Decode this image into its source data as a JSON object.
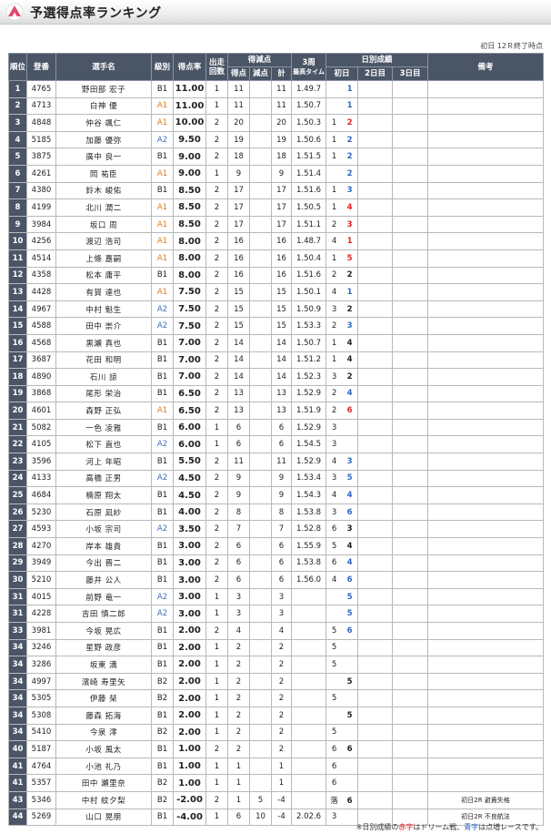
{
  "header": {
    "title": "予選得点率ランキング"
  },
  "status": "初日 12Ｒ終了時点",
  "columns": {
    "rank": "順位",
    "reg": "登番",
    "name": "選手名",
    "class": "級別",
    "rate": "得点率",
    "starts_top": "出走",
    "starts_bot": "回数",
    "points_group": "得減点",
    "got": "得点",
    "minus": "減点",
    "total": "計",
    "lap_top": "3周",
    "lap_bot": "最高タイム",
    "daily_group": "日別成績",
    "day1": "初日",
    "day2": "2日目",
    "day3": "3日目",
    "remarks": "備考"
  },
  "colors": {
    "header_bg": "#4a5566",
    "class_A1": "#e07a1b",
    "class_A2": "#3c6dc0",
    "dream_red": "#e52222",
    "feature_blue": "#2f66c2"
  },
  "rows": [
    {
      "rank": "1",
      "reg": "4765",
      "name": "野田部 宏子",
      "cls": "B1",
      "rate": "11.00",
      "starts": "1",
      "got": "11",
      "minus": "",
      "total": "11",
      "lap": "1.49.7",
      "d1a": "",
      "d1b": "1",
      "d1bc": "blue",
      "remark": ""
    },
    {
      "rank": "2",
      "reg": "4713",
      "name": "白神 優",
      "cls": "A1",
      "rate": "11.00",
      "starts": "1",
      "got": "11",
      "minus": "",
      "total": "11",
      "lap": "1.50.7",
      "d1a": "",
      "d1b": "1",
      "d1bc": "blue",
      "remark": ""
    },
    {
      "rank": "3",
      "reg": "4848",
      "name": "仲谷 颯仁",
      "cls": "A1",
      "rate": "10.00",
      "starts": "2",
      "got": "20",
      "minus": "",
      "total": "20",
      "lap": "1.50.3",
      "d1a": "1",
      "d1b": "2",
      "d1bc": "red",
      "remark": ""
    },
    {
      "rank": "4",
      "reg": "5185",
      "name": "加藤 優弥",
      "cls": "A2",
      "rate": "9.50",
      "starts": "2",
      "got": "19",
      "minus": "",
      "total": "19",
      "lap": "1.50.6",
      "d1a": "1",
      "d1b": "2",
      "d1bc": "blue",
      "remark": ""
    },
    {
      "rank": "5",
      "reg": "3875",
      "name": "廣中 良一",
      "cls": "B1",
      "rate": "9.00",
      "starts": "2",
      "got": "18",
      "minus": "",
      "total": "18",
      "lap": "1.51.5",
      "d1a": "1",
      "d1b": "2",
      "d1bc": "blue",
      "remark": ""
    },
    {
      "rank": "6",
      "reg": "4261",
      "name": "岡 祐臣",
      "cls": "A1",
      "rate": "9.00",
      "starts": "1",
      "got": "9",
      "minus": "",
      "total": "9",
      "lap": "1.51.4",
      "d1a": "",
      "d1b": "2",
      "d1bc": "blue",
      "remark": ""
    },
    {
      "rank": "7",
      "reg": "4380",
      "name": "鈴木 峻佑",
      "cls": "B1",
      "rate": "8.50",
      "starts": "2",
      "got": "17",
      "minus": "",
      "total": "17",
      "lap": "1.51.6",
      "d1a": "1",
      "d1b": "3",
      "d1bc": "blue",
      "remark": ""
    },
    {
      "rank": "8",
      "reg": "4199",
      "name": "北川 潤二",
      "cls": "A1",
      "rate": "8.50",
      "starts": "2",
      "got": "17",
      "minus": "",
      "total": "17",
      "lap": "1.50.5",
      "d1a": "1",
      "d1b": "4",
      "d1bc": "red",
      "remark": ""
    },
    {
      "rank": "9",
      "reg": "3984",
      "name": "坂口 周",
      "cls": "A1",
      "rate": "8.50",
      "starts": "2",
      "got": "17",
      "minus": "",
      "total": "17",
      "lap": "1.51.1",
      "d1a": "2",
      "d1b": "3",
      "d1bc": "red",
      "remark": ""
    },
    {
      "rank": "10",
      "reg": "4256",
      "name": "渡辺 浩司",
      "cls": "A1",
      "rate": "8.00",
      "starts": "2",
      "got": "16",
      "minus": "",
      "total": "16",
      "lap": "1.48.7",
      "d1a": "4",
      "d1b": "1",
      "d1bc": "red",
      "remark": ""
    },
    {
      "rank": "11",
      "reg": "4514",
      "name": "上條 嘉嗣",
      "cls": "A1",
      "rate": "8.00",
      "starts": "2",
      "got": "16",
      "minus": "",
      "total": "16",
      "lap": "1.50.4",
      "d1a": "1",
      "d1b": "5",
      "d1bc": "red",
      "remark": ""
    },
    {
      "rank": "12",
      "reg": "4358",
      "name": "松本 庸平",
      "cls": "B1",
      "rate": "8.00",
      "starts": "2",
      "got": "16",
      "minus": "",
      "total": "16",
      "lap": "1.51.6",
      "d1a": "2",
      "d1b": "2",
      "d1bc": "blk",
      "remark": ""
    },
    {
      "rank": "13",
      "reg": "4428",
      "name": "有賀 達也",
      "cls": "A1",
      "rate": "7.50",
      "starts": "2",
      "got": "15",
      "minus": "",
      "total": "15",
      "lap": "1.50.1",
      "d1a": "4",
      "d1b": "1",
      "d1bc": "blue",
      "remark": ""
    },
    {
      "rank": "14",
      "reg": "4967",
      "name": "中村 魁生",
      "cls": "A2",
      "rate": "7.50",
      "starts": "2",
      "got": "15",
      "minus": "",
      "total": "15",
      "lap": "1.50.9",
      "d1a": "3",
      "d1b": "2",
      "d1bc": "blk",
      "remark": ""
    },
    {
      "rank": "15",
      "reg": "4588",
      "name": "田中 崇介",
      "cls": "A2",
      "rate": "7.50",
      "starts": "2",
      "got": "15",
      "minus": "",
      "total": "15",
      "lap": "1.53.3",
      "d1a": "2",
      "d1b": "3",
      "d1bc": "blue",
      "remark": ""
    },
    {
      "rank": "16",
      "reg": "4568",
      "name": "黒瀬 真也",
      "cls": "B1",
      "rate": "7.00",
      "starts": "2",
      "got": "14",
      "minus": "",
      "total": "14",
      "lap": "1.50.7",
      "d1a": "1",
      "d1b": "4",
      "d1bc": "blk",
      "remark": ""
    },
    {
      "rank": "17",
      "reg": "3687",
      "name": "花田 和明",
      "cls": "B1",
      "rate": "7.00",
      "starts": "2",
      "got": "14",
      "minus": "",
      "total": "14",
      "lap": "1.51.2",
      "d1a": "1",
      "d1b": "4",
      "d1bc": "blk",
      "remark": ""
    },
    {
      "rank": "18",
      "reg": "4890",
      "name": "石川 諒",
      "cls": "B1",
      "rate": "7.00",
      "starts": "2",
      "got": "14",
      "minus": "",
      "total": "14",
      "lap": "1.52.3",
      "d1a": "3",
      "d1b": "2",
      "d1bc": "blk",
      "remark": ""
    },
    {
      "rank": "19",
      "reg": "3868",
      "name": "尾形 栄治",
      "cls": "B1",
      "rate": "6.50",
      "starts": "2",
      "got": "13",
      "minus": "",
      "total": "13",
      "lap": "1.52.9",
      "d1a": "2",
      "d1b": "4",
      "d1bc": "blue",
      "remark": ""
    },
    {
      "rank": "20",
      "reg": "4601",
      "name": "森野 正弘",
      "cls": "A1",
      "rate": "6.50",
      "starts": "2",
      "got": "13",
      "minus": "",
      "total": "13",
      "lap": "1.51.9",
      "d1a": "2",
      "d1b": "6",
      "d1bc": "red",
      "remark": ""
    },
    {
      "rank": "21",
      "reg": "5082",
      "name": "一色 凌雅",
      "cls": "B1",
      "rate": "6.00",
      "starts": "1",
      "got": "6",
      "minus": "",
      "total": "6",
      "lap": "1.52.9",
      "d1a": "3",
      "d1b": "",
      "d1bc": "blk",
      "remark": ""
    },
    {
      "rank": "22",
      "reg": "4105",
      "name": "松下 直也",
      "cls": "A2",
      "rate": "6.00",
      "starts": "1",
      "got": "6",
      "minus": "",
      "total": "6",
      "lap": "1.54.5",
      "d1a": "3",
      "d1b": "",
      "d1bc": "blk",
      "remark": ""
    },
    {
      "rank": "23",
      "reg": "3596",
      "name": "河上 年昭",
      "cls": "B1",
      "rate": "5.50",
      "starts": "2",
      "got": "11",
      "minus": "",
      "total": "11",
      "lap": "1.52.9",
      "d1a": "4",
      "d1b": "3",
      "d1bc": "blue",
      "remark": ""
    },
    {
      "rank": "24",
      "reg": "4133",
      "name": "高橋 正男",
      "cls": "A2",
      "rate": "4.50",
      "starts": "2",
      "got": "9",
      "minus": "",
      "total": "9",
      "lap": "1.53.4",
      "d1a": "3",
      "d1b": "5",
      "d1bc": "blue",
      "remark": ""
    },
    {
      "rank": "25",
      "reg": "4684",
      "name": "楠原 翔太",
      "cls": "B1",
      "rate": "4.50",
      "starts": "2",
      "got": "9",
      "minus": "",
      "total": "9",
      "lap": "1.54.3",
      "d1a": "4",
      "d1b": "4",
      "d1bc": "blue",
      "remark": ""
    },
    {
      "rank": "26",
      "reg": "5230",
      "name": "石原 凪紗",
      "cls": "B1",
      "rate": "4.00",
      "starts": "2",
      "got": "8",
      "minus": "",
      "total": "8",
      "lap": "1.53.8",
      "d1a": "3",
      "d1b": "6",
      "d1bc": "blue",
      "remark": ""
    },
    {
      "rank": "27",
      "reg": "4593",
      "name": "小坂 宗司",
      "cls": "A2",
      "rate": "3.50",
      "starts": "2",
      "got": "7",
      "minus": "",
      "total": "7",
      "lap": "1.52.8",
      "d1a": "6",
      "d1b": "3",
      "d1bc": "blk",
      "remark": ""
    },
    {
      "rank": "28",
      "reg": "4270",
      "name": "岸本 雄貴",
      "cls": "B1",
      "rate": "3.00",
      "starts": "2",
      "got": "6",
      "minus": "",
      "total": "6",
      "lap": "1.55.9",
      "d1a": "5",
      "d1b": "4",
      "d1bc": "blk",
      "remark": ""
    },
    {
      "rank": "29",
      "reg": "3949",
      "name": "今出 晋二",
      "cls": "B1",
      "rate": "3.00",
      "starts": "2",
      "got": "6",
      "minus": "",
      "total": "6",
      "lap": "1.53.8",
      "d1a": "6",
      "d1b": "4",
      "d1bc": "blue",
      "remark": ""
    },
    {
      "rank": "30",
      "reg": "5210",
      "name": "藤井 公人",
      "cls": "B1",
      "rate": "3.00",
      "starts": "2",
      "got": "6",
      "minus": "",
      "total": "6",
      "lap": "1.56.0",
      "d1a": "4",
      "d1b": "6",
      "d1bc": "blue",
      "remark": ""
    },
    {
      "rank": "31",
      "reg": "4015",
      "name": "前野 竜一",
      "cls": "A2",
      "rate": "3.00",
      "starts": "1",
      "got": "3",
      "minus": "",
      "total": "3",
      "lap": "",
      "d1a": "",
      "d1b": "5",
      "d1bc": "blue",
      "remark": ""
    },
    {
      "rank": "31",
      "reg": "4228",
      "name": "吉田 慎二郎",
      "cls": "A2",
      "rate": "3.00",
      "starts": "1",
      "got": "3",
      "minus": "",
      "total": "3",
      "lap": "",
      "d1a": "",
      "d1b": "5",
      "d1bc": "blue",
      "remark": ""
    },
    {
      "rank": "33",
      "reg": "3981",
      "name": "今坂 晃広",
      "cls": "B1",
      "rate": "2.00",
      "starts": "2",
      "got": "4",
      "minus": "",
      "total": "4",
      "lap": "",
      "d1a": "5",
      "d1b": "6",
      "d1bc": "blue",
      "remark": ""
    },
    {
      "rank": "34",
      "reg": "3246",
      "name": "星野 政彦",
      "cls": "B1",
      "rate": "2.00",
      "starts": "1",
      "got": "2",
      "minus": "",
      "total": "2",
      "lap": "",
      "d1a": "5",
      "d1b": "",
      "d1bc": "blk",
      "remark": ""
    },
    {
      "rank": "34",
      "reg": "3286",
      "name": "坂東 満",
      "cls": "B1",
      "rate": "2.00",
      "starts": "1",
      "got": "2",
      "minus": "",
      "total": "2",
      "lap": "",
      "d1a": "5",
      "d1b": "",
      "d1bc": "blk",
      "remark": ""
    },
    {
      "rank": "34",
      "reg": "4997",
      "name": "濱崎 寿里矢",
      "cls": "B2",
      "rate": "2.00",
      "starts": "1",
      "got": "2",
      "minus": "",
      "total": "2",
      "lap": "",
      "d1a": "",
      "d1b": "5",
      "d1bc": "blk",
      "remark": ""
    },
    {
      "rank": "34",
      "reg": "5305",
      "name": "伊藤 栞",
      "cls": "B2",
      "rate": "2.00",
      "starts": "1",
      "got": "2",
      "minus": "",
      "total": "2",
      "lap": "",
      "d1a": "5",
      "d1b": "",
      "d1bc": "blk",
      "remark": ""
    },
    {
      "rank": "34",
      "reg": "5308",
      "name": "藤森 拓海",
      "cls": "B1",
      "rate": "2.00",
      "starts": "1",
      "got": "2",
      "minus": "",
      "total": "2",
      "lap": "",
      "d1a": "",
      "d1b": "5",
      "d1bc": "blk",
      "remark": ""
    },
    {
      "rank": "34",
      "reg": "5410",
      "name": "今泉 澪",
      "cls": "B2",
      "rate": "2.00",
      "starts": "1",
      "got": "2",
      "minus": "",
      "total": "2",
      "lap": "",
      "d1a": "5",
      "d1b": "",
      "d1bc": "blk",
      "remark": ""
    },
    {
      "rank": "40",
      "reg": "5187",
      "name": "小坂 風太",
      "cls": "B1",
      "rate": "1.00",
      "starts": "2",
      "got": "2",
      "minus": "",
      "total": "2",
      "lap": "",
      "d1a": "6",
      "d1b": "6",
      "d1bc": "blk",
      "remark": ""
    },
    {
      "rank": "41",
      "reg": "4764",
      "name": "小池 礼乃",
      "cls": "B1",
      "rate": "1.00",
      "starts": "1",
      "got": "1",
      "minus": "",
      "total": "1",
      "lap": "",
      "d1a": "6",
      "d1b": "",
      "d1bc": "blk",
      "remark": ""
    },
    {
      "rank": "41",
      "reg": "5357",
      "name": "田中 瀬里奈",
      "cls": "B2",
      "rate": "1.00",
      "starts": "1",
      "got": "1",
      "minus": "",
      "total": "1",
      "lap": "",
      "d1a": "6",
      "d1b": "",
      "d1bc": "blk",
      "remark": ""
    },
    {
      "rank": "43",
      "reg": "5346",
      "name": "中村 紋夕梨",
      "cls": "B2",
      "rate": "-2.00",
      "starts": "2",
      "got": "1",
      "minus": "5",
      "total": "-4",
      "lap": "",
      "d1a": "落",
      "d1b": "6",
      "d1bc": "blk",
      "remark": "初日2R 避責失格"
    },
    {
      "rank": "44",
      "reg": "5269",
      "name": "山口 晃朋",
      "cls": "B1",
      "rate": "-4.00",
      "starts": "1",
      "got": "6",
      "minus": "10",
      "total": "-4",
      "lap": "2.02.6",
      "d1a": "3",
      "d1b": "",
      "d1bc": "blk",
      "remark": "初日2R 不良航法"
    }
  ],
  "footer": {
    "pre": "※日別成績の",
    "red": "赤字",
    "mid": "はドリーム戦、",
    "blue": "青字",
    "post": "は点増レースです。"
  }
}
